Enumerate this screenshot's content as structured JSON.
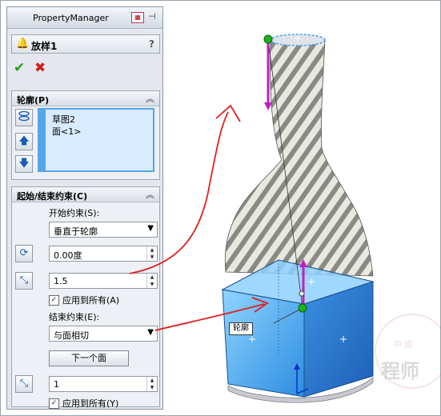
{
  "panel": {
    "title": "PropertyManager",
    "feature_name": "放样1",
    "help": "?",
    "ok": "✔",
    "cancel": "✖"
  },
  "profiles": {
    "header": "轮廓(P)",
    "items": [
      "草图2",
      "面<1>"
    ]
  },
  "constraints": {
    "header": "起始/结束约束(C)",
    "start_label": "开始约束(S):",
    "start_value": "垂直于轮廓",
    "start_angle": "0.00度",
    "start_length": "1.5",
    "start_apply_all": "应用到所有(A)",
    "end_label": "结束约束(E):",
    "end_value": "与面相切",
    "next_face": "下一个面",
    "end_length": "1",
    "end_apply_all": "应用到所有(Y)"
  },
  "viewport": {
    "callout": "轮廓",
    "watermark": "程师",
    "watermark_small": "中 國"
  },
  "colors": {
    "accent_blue": "#56a6e8",
    "arrow_magenta": "#c020c0",
    "annotation_red": "#e02020"
  }
}
